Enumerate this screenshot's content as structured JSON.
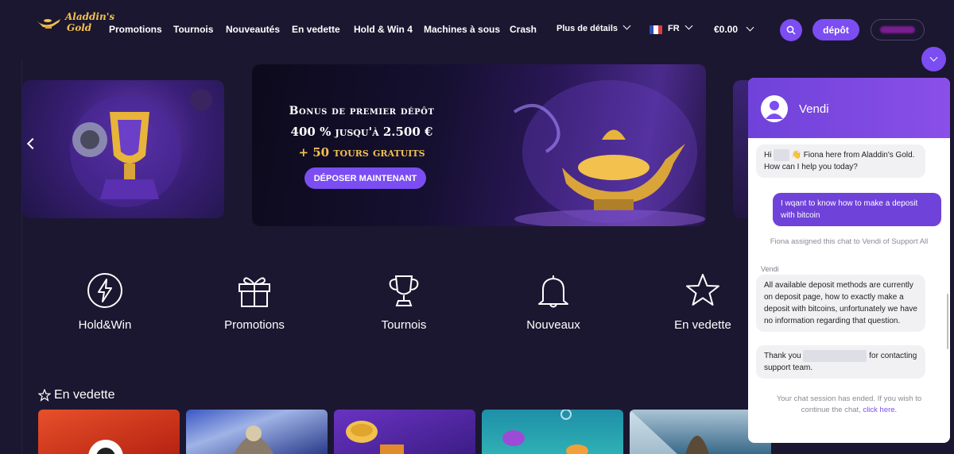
{
  "brand": {
    "name_line1": "Aladdin's",
    "name_line2": "Gold",
    "colors": {
      "background": "#1b1730",
      "accent": "#7b4df2",
      "gold": "#f2c14e"
    }
  },
  "nav": {
    "items": [
      "Promotions",
      "Tournois",
      "Nouveautés",
      "En vedette",
      "Hold & Win 4",
      "Machines à sous",
      "Crash"
    ],
    "more_label": "Plus de détails",
    "language": "FR",
    "balance": "€0.00",
    "deposit_label": "dépôt"
  },
  "hero": {
    "line1": "Bonus de premier dépôt",
    "line2": "400 % jusqu'à 2.500 €",
    "line3": "+ 50 tours gratuits",
    "cta": "DÉPOSER MAINTENANT"
  },
  "categories": [
    {
      "label": "Hold&Win",
      "icon": "lightning-icon"
    },
    {
      "label": "Promotions",
      "icon": "gift-icon"
    },
    {
      "label": "Tournois",
      "icon": "trophy-icon"
    },
    {
      "label": "Nouveaux",
      "icon": "bell-icon"
    },
    {
      "label": "En vedette",
      "icon": "star-icon"
    }
  ],
  "featured": {
    "title": "En vedette",
    "tile_colors": [
      "#d8351f",
      "#2d4aa6",
      "#5a2aa8",
      "#1f8aa0",
      "#c9d6e0",
      "#3c63a8"
    ]
  },
  "chat": {
    "agent_name": "Vendi",
    "messages": [
      {
        "from": "agent",
        "text_prefix": "Hi ",
        "text_redacted": "......!",
        "text": "👋 Fiona here from Aladdin's Gold. How can I help you today?"
      },
      {
        "from": "user",
        "text": "I wqant to know how to make a deposit with bitcoin"
      }
    ],
    "system_assign": "Fiona assigned this chat to Vendi of Support All",
    "sender_label": "Vendi",
    "reply1": "All available deposit methods are currently on deposit page, how to exactly make a deposit with bitcoins, unfortunately we have no information regarding that question.",
    "reply2_prefix": "Thank you",
    "reply2_redacted": "xxxxxxxxxxxxxxxxxx",
    "reply2_suffix": "for contacting support team.",
    "ended_text": "Your chat session has ended. If you wish to continue the chat,",
    "ended_link": "click here."
  }
}
